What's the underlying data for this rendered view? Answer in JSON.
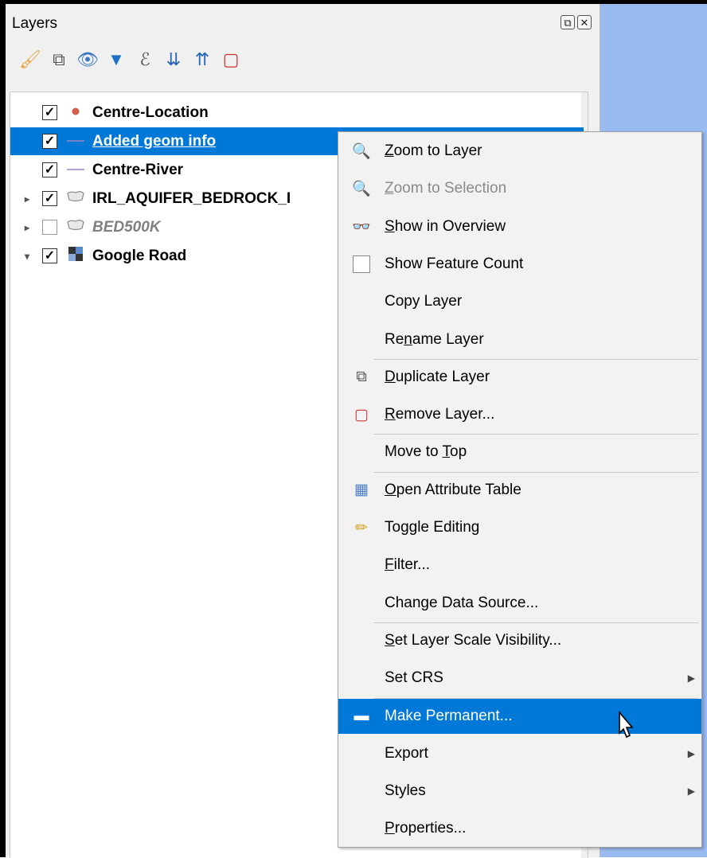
{
  "panel": {
    "title": "Layers",
    "buttons": [
      "restore-icon",
      "close-icon"
    ]
  },
  "toolbar": [
    {
      "icon": "style-brush-icon",
      "glyph": "🖌"
    },
    {
      "icon": "add-group-icon",
      "glyph": "⧉"
    },
    {
      "icon": "manage-visibility-icon",
      "glyph": "👁"
    },
    {
      "icon": "filter-legend-icon",
      "glyph": "▼"
    },
    {
      "icon": "expression-filter-icon",
      "glyph": "ℰ"
    },
    {
      "icon": "expand-all-icon",
      "glyph": "⇊"
    },
    {
      "icon": "collapse-all-icon",
      "glyph": "⇈"
    },
    {
      "icon": "remove-layer-icon",
      "glyph": "▢"
    }
  ],
  "layers": [
    {
      "label": "Centre-Location",
      "checked": true,
      "icon": "point-icon",
      "expander": "",
      "style": "normal"
    },
    {
      "label": "Added geom info",
      "checked": true,
      "icon": "line-icon",
      "expander": "",
      "style": "selected"
    },
    {
      "label": "Centre-River",
      "checked": true,
      "icon": "line-icon",
      "expander": "",
      "style": "normal"
    },
    {
      "label": "IRL_AQUIFER_BEDROCK_I",
      "checked": true,
      "icon": "polygon-icon",
      "expander": "▸",
      "style": "normal"
    },
    {
      "label": "BED500K",
      "checked": false,
      "icon": "polygon-icon",
      "expander": "▸",
      "style": "italic"
    },
    {
      "label": "Google Road",
      "checked": true,
      "icon": "raster-icon",
      "expander": "▾",
      "style": "normal"
    }
  ],
  "menu": {
    "items": [
      {
        "pre": "",
        "u": "Z",
        "post": "oom to Layer",
        "icon": "zoom-layer-icon",
        "glyph": "🔍",
        "state": "normal"
      },
      {
        "pre": "",
        "u": "Z",
        "post": "oom to Selection",
        "icon": "zoom-selection-icon",
        "glyph": "🔍",
        "state": "disabled"
      },
      {
        "pre": "",
        "u": "S",
        "post": "how in Overview",
        "icon": "overview-icon",
        "glyph": "👓",
        "state": "normal"
      },
      {
        "pre": "Show Feature Count",
        "u": "",
        "post": "",
        "icon": "checkbox-icon",
        "glyph": "",
        "state": "normal"
      },
      {
        "pre": "Copy Layer",
        "u": "",
        "post": "",
        "icon": "",
        "glyph": "",
        "state": "normal"
      },
      {
        "pre": "Re",
        "u": "n",
        "post": "ame Layer",
        "icon": "",
        "glyph": "",
        "state": "normal"
      },
      {
        "pre": "",
        "u": "D",
        "post": "uplicate Layer",
        "icon": "duplicate-layer-icon",
        "glyph": "⧉",
        "state": "normal"
      },
      {
        "pre": "",
        "u": "R",
        "post": "emove Layer...",
        "icon": "remove-layer-icon",
        "glyph": "▢",
        "state": "normal"
      },
      {
        "pre": "Move to ",
        "u": "T",
        "post": "op",
        "icon": "",
        "glyph": "",
        "state": "normal"
      },
      {
        "pre": "",
        "u": "O",
        "post": "pen Attribute Table",
        "icon": "attribute-table-icon",
        "glyph": "▦",
        "state": "normal"
      },
      {
        "pre": "Toggle Editing",
        "u": "",
        "post": "",
        "icon": "pencil-icon",
        "glyph": "✏",
        "state": "normal"
      },
      {
        "pre": "",
        "u": "F",
        "post": "ilter...",
        "icon": "",
        "glyph": "",
        "state": "normal"
      },
      {
        "pre": "Change Data Source...",
        "u": "",
        "post": "",
        "icon": "",
        "glyph": "",
        "state": "normal"
      },
      {
        "pre": "",
        "u": "S",
        "post": "et Layer Scale Visibility...",
        "icon": "",
        "glyph": "",
        "state": "normal"
      },
      {
        "pre": "Set CRS",
        "u": "",
        "post": "",
        "icon": "",
        "glyph": "",
        "state": "normal",
        "submenu": true
      },
      {
        "pre": "Make Permanent...",
        "u": "",
        "post": "",
        "icon": "save-icon",
        "glyph": "▬",
        "state": "highlighted"
      },
      {
        "pre": "Export",
        "u": "",
        "post": "",
        "icon": "",
        "glyph": "",
        "state": "normal",
        "submenu": true
      },
      {
        "pre": "Styles",
        "u": "",
        "post": "",
        "icon": "",
        "glyph": "",
        "state": "normal",
        "submenu": true
      },
      {
        "pre": "",
        "u": "P",
        "post": "roperties...",
        "icon": "",
        "glyph": "",
        "state": "normal"
      }
    ],
    "separators_after": [
      5,
      7,
      8,
      12,
      14
    ]
  },
  "colors": {
    "selection": "#0078d7",
    "canvas": "#99bbf2",
    "point": "#d2604a",
    "line": "#9b80c2"
  }
}
